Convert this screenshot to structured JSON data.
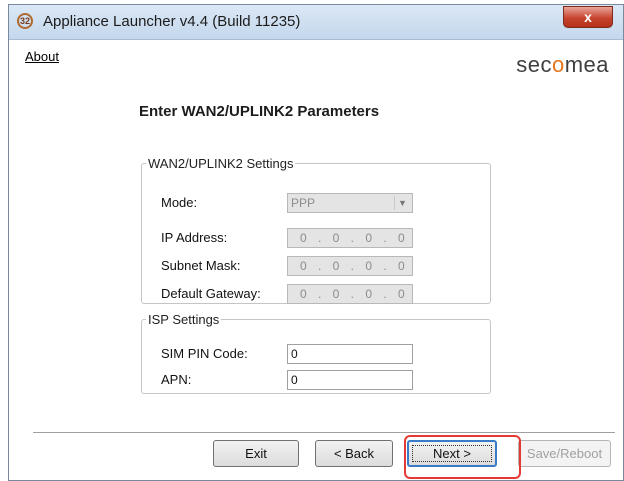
{
  "window": {
    "title": "Appliance Launcher v4.4 (Build 11235)",
    "close_glyph": "x",
    "icon_text": "32"
  },
  "menu": {
    "about": "About"
  },
  "logo": {
    "pre": "sec",
    "o": "o",
    "post": "mea",
    "accent_color": "#e5761d"
  },
  "heading": "Enter WAN2/UPLINK2 Parameters",
  "wan_group": {
    "legend": "WAN2/UPLINK2 Settings",
    "mode_label": "Mode:",
    "mode_value": "PPP",
    "ip_label": "IP Address:",
    "ip_value": "0 . 0 . 0 . 0",
    "subnet_label": "Subnet Mask:",
    "subnet_value": "0 . 0 . 0 . 0",
    "gateway_label": "Default Gateway:",
    "gateway_value": "0 . 0 . 0 . 0"
  },
  "isp_group": {
    "legend": "ISP Settings",
    "sim_label": "SIM PIN Code:",
    "sim_value": "0",
    "apn_label": "APN:",
    "apn_value": "0"
  },
  "buttons": {
    "exit": "Exit",
    "back": "< Back",
    "next": "Next >",
    "save": "Save/Reboot"
  },
  "colors": {
    "highlight": "#e53935",
    "close": "#c7442f"
  }
}
